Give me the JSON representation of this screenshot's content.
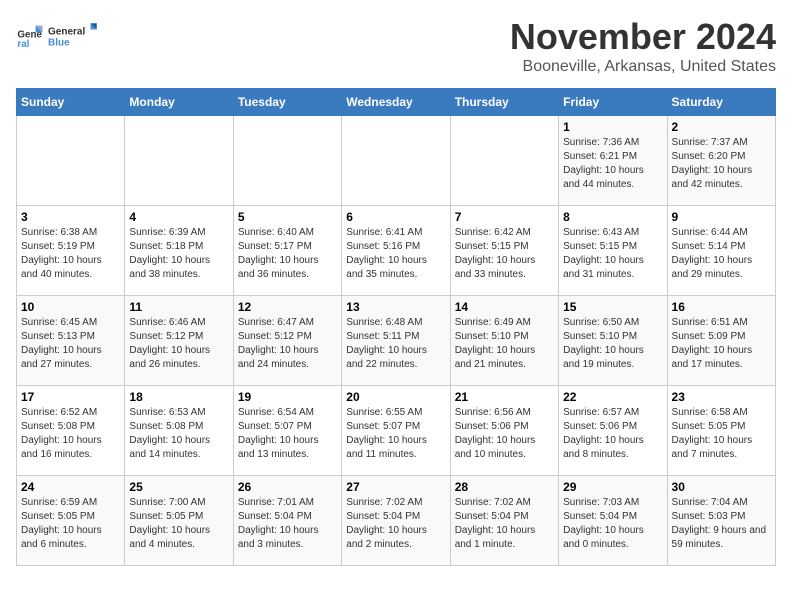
{
  "logo": {
    "line1": "General",
    "line2": "Blue"
  },
  "title": "November 2024",
  "location": "Booneville, Arkansas, United States",
  "headers": [
    "Sunday",
    "Monday",
    "Tuesday",
    "Wednesday",
    "Thursday",
    "Friday",
    "Saturday"
  ],
  "weeks": [
    [
      {
        "day": "",
        "sunrise": "",
        "sunset": "",
        "daylight": ""
      },
      {
        "day": "",
        "sunrise": "",
        "sunset": "",
        "daylight": ""
      },
      {
        "day": "",
        "sunrise": "",
        "sunset": "",
        "daylight": ""
      },
      {
        "day": "",
        "sunrise": "",
        "sunset": "",
        "daylight": ""
      },
      {
        "day": "",
        "sunrise": "",
        "sunset": "",
        "daylight": ""
      },
      {
        "day": "1",
        "sunrise": "Sunrise: 7:36 AM",
        "sunset": "Sunset: 6:21 PM",
        "daylight": "Daylight: 10 hours and 44 minutes."
      },
      {
        "day": "2",
        "sunrise": "Sunrise: 7:37 AM",
        "sunset": "Sunset: 6:20 PM",
        "daylight": "Daylight: 10 hours and 42 minutes."
      }
    ],
    [
      {
        "day": "3",
        "sunrise": "Sunrise: 6:38 AM",
        "sunset": "Sunset: 5:19 PM",
        "daylight": "Daylight: 10 hours and 40 minutes."
      },
      {
        "day": "4",
        "sunrise": "Sunrise: 6:39 AM",
        "sunset": "Sunset: 5:18 PM",
        "daylight": "Daylight: 10 hours and 38 minutes."
      },
      {
        "day": "5",
        "sunrise": "Sunrise: 6:40 AM",
        "sunset": "Sunset: 5:17 PM",
        "daylight": "Daylight: 10 hours and 36 minutes."
      },
      {
        "day": "6",
        "sunrise": "Sunrise: 6:41 AM",
        "sunset": "Sunset: 5:16 PM",
        "daylight": "Daylight: 10 hours and 35 minutes."
      },
      {
        "day": "7",
        "sunrise": "Sunrise: 6:42 AM",
        "sunset": "Sunset: 5:15 PM",
        "daylight": "Daylight: 10 hours and 33 minutes."
      },
      {
        "day": "8",
        "sunrise": "Sunrise: 6:43 AM",
        "sunset": "Sunset: 5:15 PM",
        "daylight": "Daylight: 10 hours and 31 minutes."
      },
      {
        "day": "9",
        "sunrise": "Sunrise: 6:44 AM",
        "sunset": "Sunset: 5:14 PM",
        "daylight": "Daylight: 10 hours and 29 minutes."
      }
    ],
    [
      {
        "day": "10",
        "sunrise": "Sunrise: 6:45 AM",
        "sunset": "Sunset: 5:13 PM",
        "daylight": "Daylight: 10 hours and 27 minutes."
      },
      {
        "day": "11",
        "sunrise": "Sunrise: 6:46 AM",
        "sunset": "Sunset: 5:12 PM",
        "daylight": "Daylight: 10 hours and 26 minutes."
      },
      {
        "day": "12",
        "sunrise": "Sunrise: 6:47 AM",
        "sunset": "Sunset: 5:12 PM",
        "daylight": "Daylight: 10 hours and 24 minutes."
      },
      {
        "day": "13",
        "sunrise": "Sunrise: 6:48 AM",
        "sunset": "Sunset: 5:11 PM",
        "daylight": "Daylight: 10 hours and 22 minutes."
      },
      {
        "day": "14",
        "sunrise": "Sunrise: 6:49 AM",
        "sunset": "Sunset: 5:10 PM",
        "daylight": "Daylight: 10 hours and 21 minutes."
      },
      {
        "day": "15",
        "sunrise": "Sunrise: 6:50 AM",
        "sunset": "Sunset: 5:10 PM",
        "daylight": "Daylight: 10 hours and 19 minutes."
      },
      {
        "day": "16",
        "sunrise": "Sunrise: 6:51 AM",
        "sunset": "Sunset: 5:09 PM",
        "daylight": "Daylight: 10 hours and 17 minutes."
      }
    ],
    [
      {
        "day": "17",
        "sunrise": "Sunrise: 6:52 AM",
        "sunset": "Sunset: 5:08 PM",
        "daylight": "Daylight: 10 hours and 16 minutes."
      },
      {
        "day": "18",
        "sunrise": "Sunrise: 6:53 AM",
        "sunset": "Sunset: 5:08 PM",
        "daylight": "Daylight: 10 hours and 14 minutes."
      },
      {
        "day": "19",
        "sunrise": "Sunrise: 6:54 AM",
        "sunset": "Sunset: 5:07 PM",
        "daylight": "Daylight: 10 hours and 13 minutes."
      },
      {
        "day": "20",
        "sunrise": "Sunrise: 6:55 AM",
        "sunset": "Sunset: 5:07 PM",
        "daylight": "Daylight: 10 hours and 11 minutes."
      },
      {
        "day": "21",
        "sunrise": "Sunrise: 6:56 AM",
        "sunset": "Sunset: 5:06 PM",
        "daylight": "Daylight: 10 hours and 10 minutes."
      },
      {
        "day": "22",
        "sunrise": "Sunrise: 6:57 AM",
        "sunset": "Sunset: 5:06 PM",
        "daylight": "Daylight: 10 hours and 8 minutes."
      },
      {
        "day": "23",
        "sunrise": "Sunrise: 6:58 AM",
        "sunset": "Sunset: 5:05 PM",
        "daylight": "Daylight: 10 hours and 7 minutes."
      }
    ],
    [
      {
        "day": "24",
        "sunrise": "Sunrise: 6:59 AM",
        "sunset": "Sunset: 5:05 PM",
        "daylight": "Daylight: 10 hours and 6 minutes."
      },
      {
        "day": "25",
        "sunrise": "Sunrise: 7:00 AM",
        "sunset": "Sunset: 5:05 PM",
        "daylight": "Daylight: 10 hours and 4 minutes."
      },
      {
        "day": "26",
        "sunrise": "Sunrise: 7:01 AM",
        "sunset": "Sunset: 5:04 PM",
        "daylight": "Daylight: 10 hours and 3 minutes."
      },
      {
        "day": "27",
        "sunrise": "Sunrise: 7:02 AM",
        "sunset": "Sunset: 5:04 PM",
        "daylight": "Daylight: 10 hours and 2 minutes."
      },
      {
        "day": "28",
        "sunrise": "Sunrise: 7:02 AM",
        "sunset": "Sunset: 5:04 PM",
        "daylight": "Daylight: 10 hours and 1 minute."
      },
      {
        "day": "29",
        "sunrise": "Sunrise: 7:03 AM",
        "sunset": "Sunset: 5:04 PM",
        "daylight": "Daylight: 10 hours and 0 minutes."
      },
      {
        "day": "30",
        "sunrise": "Sunrise: 7:04 AM",
        "sunset": "Sunset: 5:03 PM",
        "daylight": "Daylight: 9 hours and 59 minutes."
      }
    ]
  ]
}
